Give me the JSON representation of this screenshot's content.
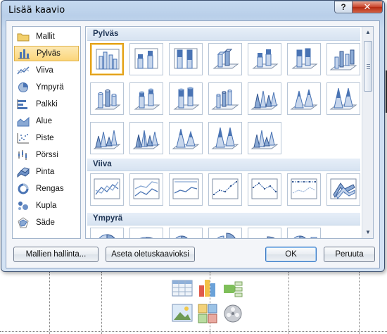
{
  "dialog": {
    "title": "Lisää kaavio",
    "help_label": "?",
    "close_label": "✕"
  },
  "categories": [
    {
      "label": "Mallit",
      "icon": "folder-icon",
      "selected": false
    },
    {
      "label": "Pylväs",
      "icon": "column-chart-icon",
      "selected": true
    },
    {
      "label": "Viiva",
      "icon": "line-chart-icon",
      "selected": false
    },
    {
      "label": "Ympyrä",
      "icon": "pie-chart-icon",
      "selected": false
    },
    {
      "label": "Palkki",
      "icon": "bar-chart-icon",
      "selected": false
    },
    {
      "label": "Alue",
      "icon": "area-chart-icon",
      "selected": false
    },
    {
      "label": "Piste",
      "icon": "scatter-chart-icon",
      "selected": false
    },
    {
      "label": "Pörssi",
      "icon": "stock-chart-icon",
      "selected": false
    },
    {
      "label": "Pinta",
      "icon": "surface-chart-icon",
      "selected": false
    },
    {
      "label": "Rengas",
      "icon": "doughnut-chart-icon",
      "selected": false
    },
    {
      "label": "Kupla",
      "icon": "bubble-chart-icon",
      "selected": false
    },
    {
      "label": "Säde",
      "icon": "radar-chart-icon",
      "selected": false
    }
  ],
  "gallery": {
    "sections": [
      {
        "title": "Pylväs"
      },
      {
        "title": "Viiva"
      },
      {
        "title": "Ympyrä"
      }
    ]
  },
  "buttons": {
    "manage_templates": "Mallien hallinta...",
    "set_default": "Aseta oletuskaavioksi",
    "ok": "OK",
    "cancel": "Peruuta"
  },
  "colors": {
    "accent_blue": "#4a74b4",
    "selection_orange": "#e3a21a"
  }
}
